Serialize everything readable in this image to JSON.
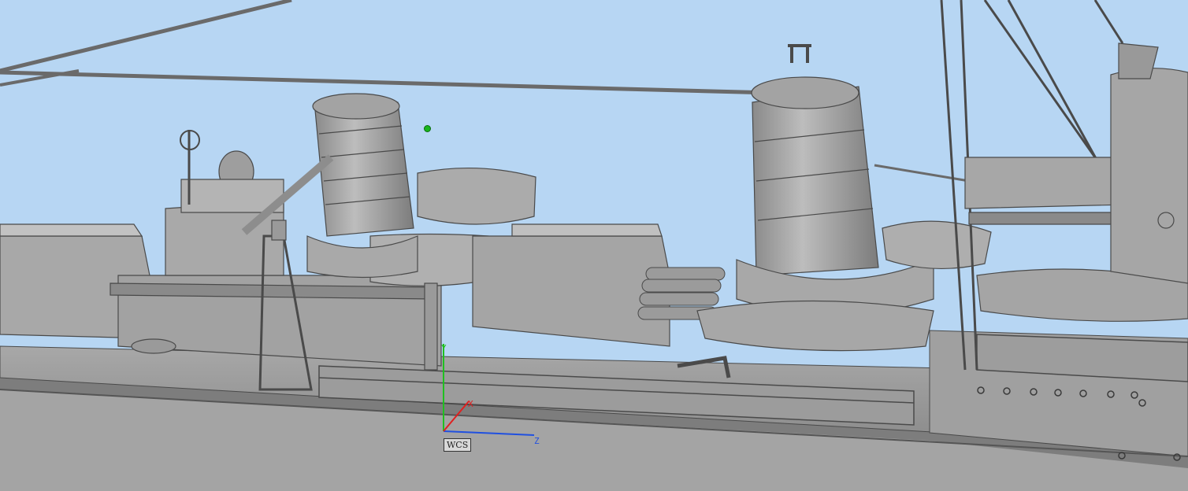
{
  "viewport": {
    "background_color": "#b7d6f3",
    "model_color": "#9a9a9a",
    "edge_color": "#4a4a4a"
  },
  "axes": {
    "label_y": "Y",
    "label_x": "X",
    "label_z": "Z",
    "color_y": "#20c020",
    "color_x": "#e02020",
    "color_z": "#2050e0",
    "wcs_label": "WCS"
  },
  "pick_point": {
    "color": "#19b51c"
  }
}
